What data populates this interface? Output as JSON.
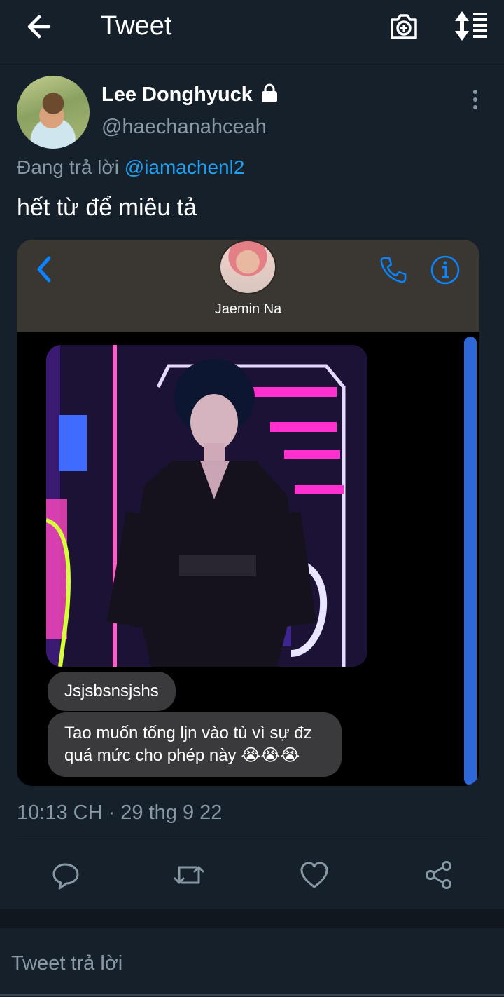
{
  "topbar": {
    "title": "Tweet",
    "back_icon": "arrow-left-icon",
    "camera_icon": "camera-plus-icon",
    "sort_icon": "sort-list-icon"
  },
  "tweet": {
    "author_name": "Lee Donghyuck",
    "author_handle": "@haechanahceah",
    "replying_prefix": "Đang trả lời",
    "replying_to": "@iamachenl2",
    "text": "hết từ để miêu tả",
    "timestamp": "10:13 CH · 29 thg 9 22"
  },
  "media": {
    "contact_name": "Jaemin Na",
    "messages": [
      "Jsjsbsnsjshs",
      "Tao muốn tống ljn vào tù vì sự đz quá mức cho phép này 😭😭😭"
    ]
  },
  "actions": {
    "reply_icon": "reply-icon",
    "retweet_icon": "retweet-icon",
    "like_icon": "heart-icon",
    "share_icon": "share-icon"
  },
  "composer": {
    "placeholder": "Tweet trả lời"
  },
  "colors": {
    "background": "#15202b",
    "accent": "#1da1f2",
    "muted": "#8899a6",
    "ios_blue": "#0a84ff"
  }
}
